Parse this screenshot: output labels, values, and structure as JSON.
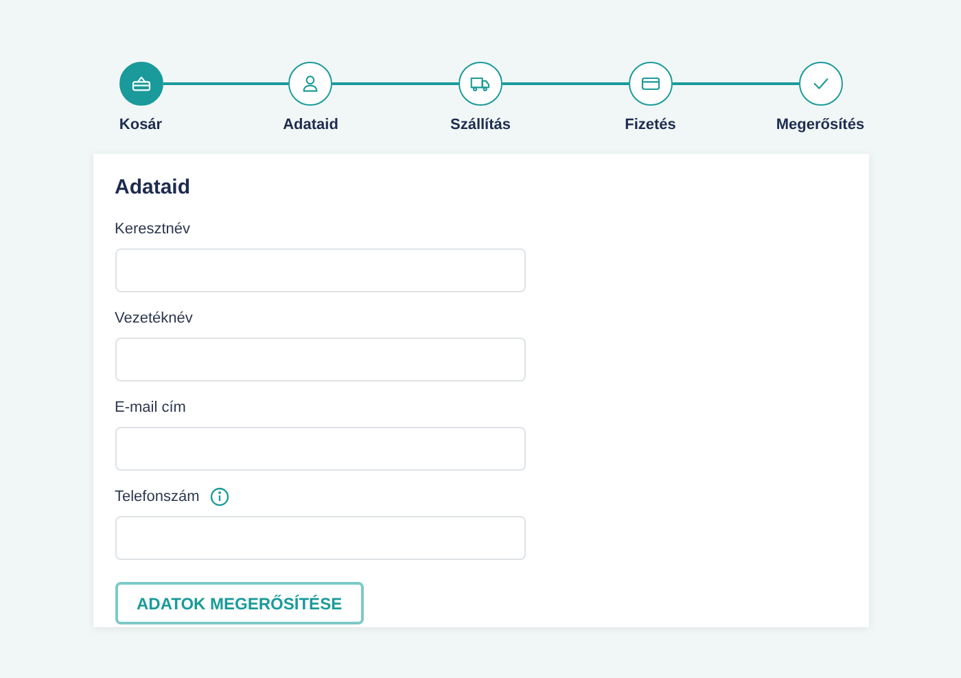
{
  "steps": [
    {
      "label": "Kosár",
      "kind": "basket",
      "selected": true
    },
    {
      "label": "Adataid",
      "kind": "user",
      "selected": false
    },
    {
      "label": "Szállítás",
      "kind": "truck",
      "selected": false
    },
    {
      "label": "Fizetés",
      "kind": "card",
      "selected": false
    },
    {
      "label": "Megerősítés",
      "kind": "check",
      "selected": false
    }
  ],
  "form": {
    "title": "Adataid",
    "fields": [
      {
        "label": "Keresztnév",
        "info": false
      },
      {
        "label": "Vezetéknév",
        "info": false
      },
      {
        "label": "E-mail cím",
        "info": false
      },
      {
        "label": "Telefonszám",
        "info": true
      }
    ],
    "button": "ADATOK MEGERŐSÍTÉSE"
  }
}
